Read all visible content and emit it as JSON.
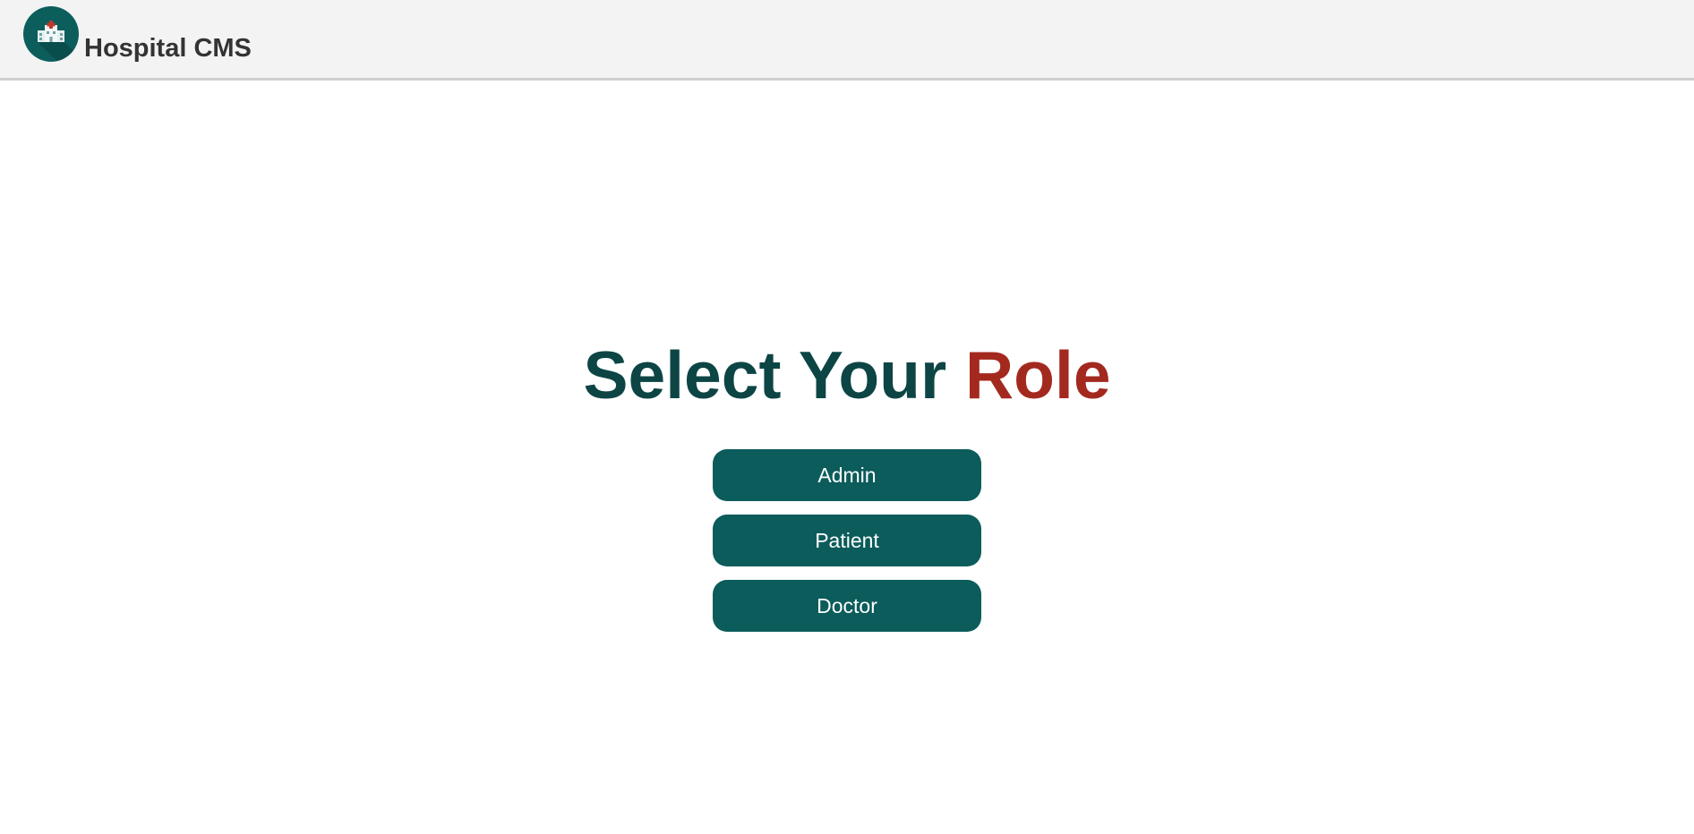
{
  "header": {
    "brand": "Hospital CMS",
    "logo_icon": "hospital-building-icon"
  },
  "main": {
    "title_part1": "Select Your ",
    "title_part2": "Role",
    "roles": [
      {
        "label": "Admin"
      },
      {
        "label": "Patient"
      },
      {
        "label": "Doctor"
      }
    ]
  },
  "colors": {
    "primary": "#0b5c5b",
    "title_dark": "#0d4545",
    "title_accent": "#a3291f",
    "header_bg": "#f3f3f3"
  }
}
